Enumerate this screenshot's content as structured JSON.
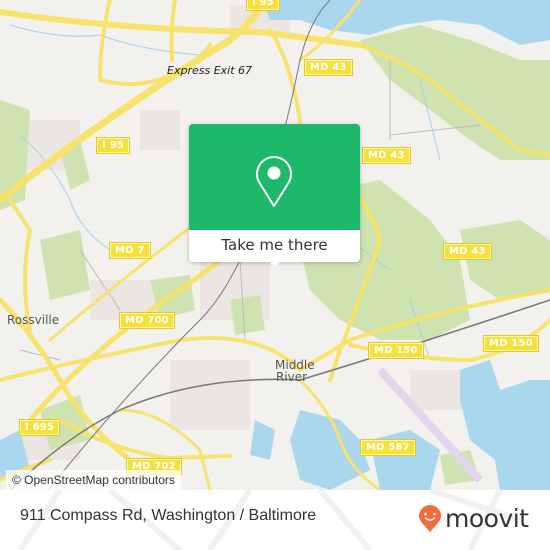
{
  "map": {
    "place_labels": [
      {
        "id": "rossville",
        "text": "Rossville"
      },
      {
        "id": "middle-river-1",
        "text": "Middle"
      },
      {
        "id": "middle-river-2",
        "text": "River"
      }
    ],
    "poi_labels": [
      {
        "id": "express-exit",
        "text": "Express Exit 67"
      }
    ],
    "road_shields": [
      {
        "id": "i95-top",
        "text": "I 95"
      },
      {
        "id": "i95",
        "text": "I 95"
      },
      {
        "id": "md43-a",
        "text": "MD 43"
      },
      {
        "id": "md43-b",
        "text": "MD 43"
      },
      {
        "id": "md43-c",
        "text": "MD 43"
      },
      {
        "id": "md7",
        "text": "MD 7"
      },
      {
        "id": "md700",
        "text": "MD 700"
      },
      {
        "id": "md150-a",
        "text": "MD 150"
      },
      {
        "id": "md150-b",
        "text": "MD 150"
      },
      {
        "id": "i695",
        "text": "I 695"
      },
      {
        "id": "md702",
        "text": "MD 702"
      },
      {
        "id": "md587",
        "text": "MD 587"
      }
    ],
    "attribution": "© OpenStreetMap contributors",
    "colors": {
      "land": "#f2f1ed",
      "park": "#cfe3b0",
      "water": "#a8d7ee",
      "road": "#f7e26b",
      "rail": "#777777",
      "runway": "#e3d4f0"
    }
  },
  "popup": {
    "icon": "map-pin-icon",
    "button_label": "Take me there",
    "accent_color": "#1db86a"
  },
  "footer": {
    "address": "911 Compass Rd, Washington / Baltimore",
    "brand": "moovit",
    "brand_color": "#f26d3d"
  }
}
